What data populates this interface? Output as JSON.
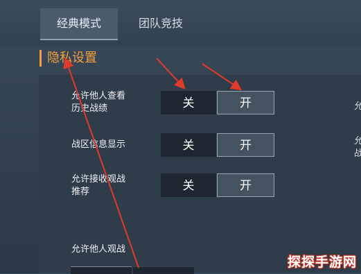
{
  "tabs": [
    {
      "label": "经典模式",
      "active": true
    },
    {
      "label": "团队竞技",
      "active": false
    }
  ],
  "section": {
    "title": "隐私设置"
  },
  "settings": [
    {
      "label_lines": [
        "允许他人查看",
        "历史战绩"
      ],
      "off": "关",
      "on": "开"
    },
    {
      "label_lines": [
        "战区信息显示"
      ],
      "off": "关",
      "on": "开"
    },
    {
      "label_lines": [
        "允许接收观战",
        "推荐"
      ],
      "off": "关",
      "on": "开"
    }
  ],
  "spectate": {
    "label": "允许他人观战"
  },
  "edge_chars": [
    "允",
    "允",
    "战"
  ],
  "watermark": "探探手游网",
  "colors": {
    "accent": "#f3a23a",
    "annotation": "#e03a2c"
  }
}
